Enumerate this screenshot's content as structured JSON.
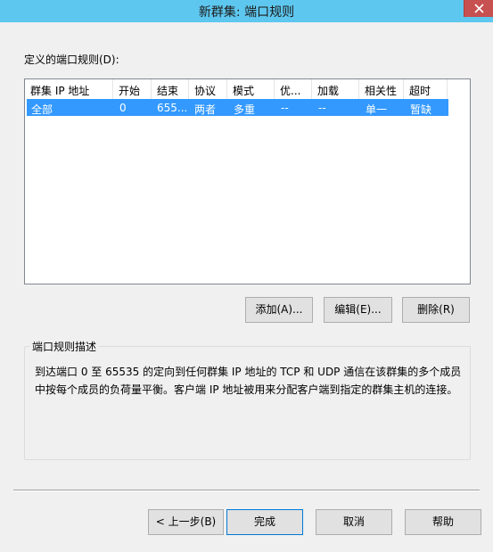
{
  "window": {
    "title": "新群集: 端口规则"
  },
  "rules_label": "定义的端口规则(D):",
  "table": {
    "columns": [
      "群集 IP 地址",
      "开始",
      "结束",
      "协议",
      "模式",
      "优...",
      "加载",
      "相关性",
      "超时"
    ],
    "rows": [
      [
        "全部",
        "0",
        "655...",
        "两者",
        "多重",
        "--",
        "--",
        "单一",
        "暂缺"
      ]
    ]
  },
  "rule_buttons": {
    "add": "添加(A)...",
    "edit": "编辑(E)...",
    "delete": "删除(R)"
  },
  "description": {
    "legend": "端口规则描述",
    "line1": "到达端口 0 至 65535 的定向到任何群集 IP 地址的 TCP 和 UDP 通信在该群集的多个成员",
    "line2": "中按每个成员的负荷量平衡。客户端 IP 地址被用来分配客户端到指定的群集主机的连接。"
  },
  "nav_buttons": {
    "back": "< 上一步(B)",
    "finish": "完成",
    "cancel": "取消",
    "help": "帮助"
  },
  "colors": {
    "titlebar": "#5ec7ef",
    "selection": "#3399ff",
    "close": "#c75050"
  }
}
